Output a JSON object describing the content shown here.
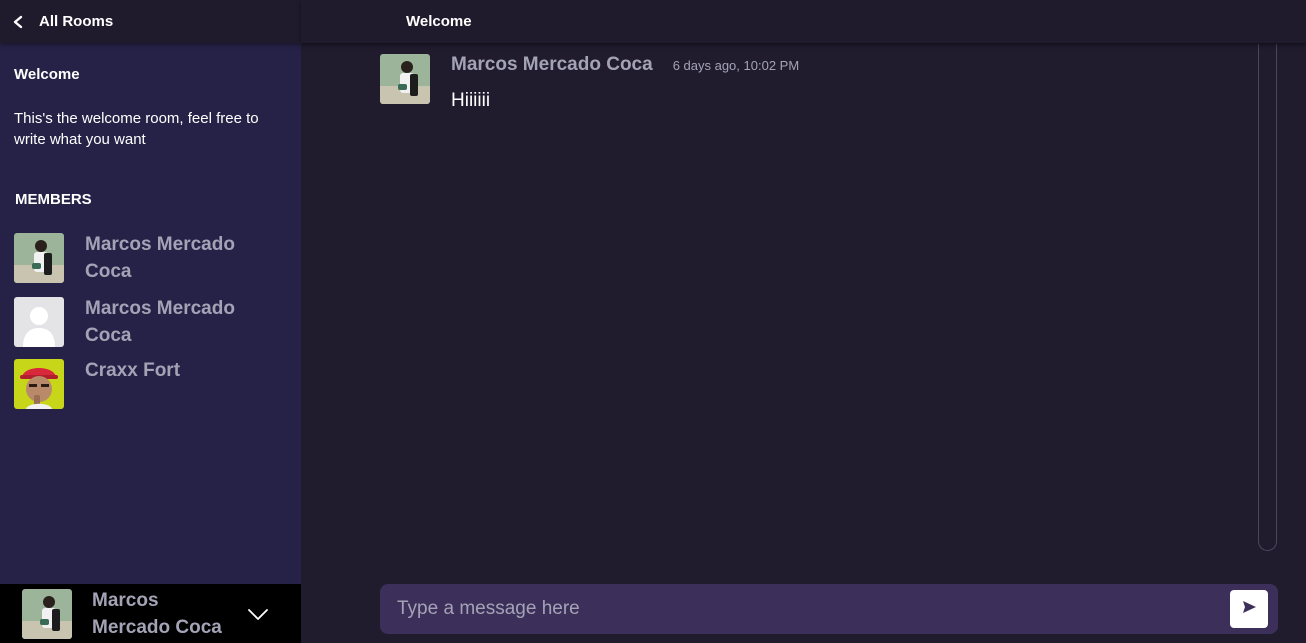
{
  "sidebar": {
    "header_title": "All Rooms",
    "back_icon": "chevron-left-icon",
    "room_name": "Welcome",
    "room_description": "This's the welcome room, feel free to write what you want",
    "members_title": "MEMBERS",
    "members": [
      {
        "name": "Marcos Mercado Coca",
        "avatar": "photo-avatar"
      },
      {
        "name": "Marcos Mercado Coca",
        "avatar": "default-silhouette-avatar"
      },
      {
        "name": "Craxx Fort",
        "avatar": "cartoon-avatar"
      }
    ]
  },
  "current_user": {
    "name": "Marcos Mercado Coca",
    "menu_icon": "chevron-down-icon"
  },
  "main": {
    "header_title": "Welcome",
    "messages": [
      {
        "author": "Marcos Mercado Coca",
        "time": "6 days ago, 10:02 PM",
        "text": "Hiiiiii"
      }
    ],
    "composer": {
      "placeholder": "Type a message here",
      "value": "",
      "send_icon": "send-icon"
    }
  },
  "colors": {
    "sidebar_bg": "#262247",
    "main_bg": "#201c2e",
    "header_bg": "#1f1b2d",
    "composer_bg": "#3c2f5a",
    "muted_text": "#a4a3b6"
  }
}
